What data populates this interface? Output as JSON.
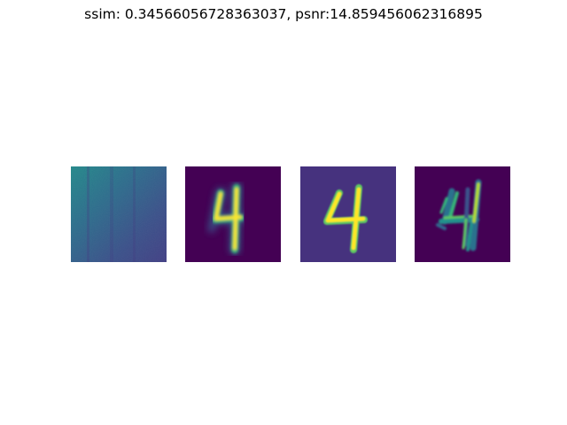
{
  "figure": {
    "title": "ssim: 0.34566056728363037, psnr:14.859456062316895"
  },
  "colors": {
    "viridis_dark": "#440154",
    "viridis_purple": "#46337e",
    "viridis_blue": "#3b528b",
    "viridis_teal": "#21918c",
    "viridis_green": "#5ec962",
    "viridis_yellow": "#fde725"
  },
  "panels": [
    {
      "id": "panel-1",
      "content": "noise-field-image"
    },
    {
      "id": "panel-2",
      "content": "digit-four-reconstruction"
    },
    {
      "id": "panel-3",
      "content": "digit-four-ground-truth"
    },
    {
      "id": "panel-4",
      "content": "digit-four-difference"
    }
  ]
}
